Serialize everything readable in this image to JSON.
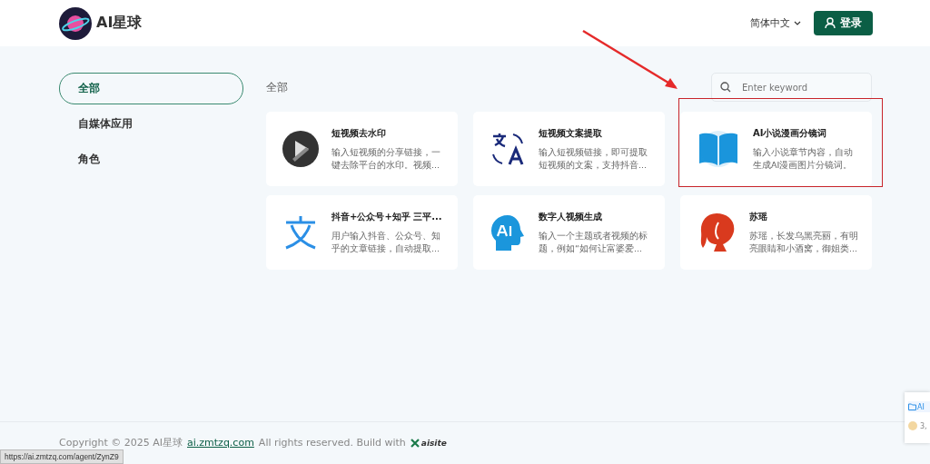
{
  "header": {
    "logo_text": "AI星球",
    "language": "简体中文",
    "login_button": "登录"
  },
  "sidebar": {
    "items": [
      {
        "label": "全部",
        "selected": true
      },
      {
        "label": "自媒体应用",
        "selected": false
      },
      {
        "label": "角色",
        "selected": false
      }
    ]
  },
  "content": {
    "heading": "全部",
    "search": {
      "placeholder": "Enter keyword"
    },
    "cards": [
      {
        "kind": "watermark",
        "title": "短视频去水印",
        "description": "输入短视频的分享链接，一键去除平台的水印。视频...",
        "highlighted": false
      },
      {
        "kind": "translate",
        "title": "短视频文案提取",
        "description": "输入短视频链接，即可提取短视频的文案，支持抖音...",
        "highlighted": false
      },
      {
        "kind": "book",
        "title": "AI小说漫画分镜词",
        "description": "输入小说章节内容，自动生成AI漫画图片分镜词。",
        "highlighted": true
      },
      {
        "kind": "text",
        "title": "抖音+公众号+知乎 三平...",
        "description": "用户输入抖音、公众号、知乎的文章链接，自动提取...",
        "highlighted": false
      },
      {
        "kind": "head",
        "title": "数字人视频生成",
        "description": "输入一个主题或者视频的标题，例如“如何让富婆爱...",
        "highlighted": false
      },
      {
        "kind": "portrait",
        "title": "苏瑶",
        "description": "苏瑶，长发乌黑亮丽，有明亮眼睛和小酒窝，御姐类...",
        "highlighted": false
      }
    ]
  },
  "side_widget": {
    "link": "AI",
    "count": "3,"
  },
  "footer": {
    "copyright": "Copyright © 2025 AI星球",
    "link": "ai.zmtzq.com",
    "rights": "All rights reserved. Build with",
    "brand": "aisite"
  },
  "status_url": "https://ai.zmtzq.com/agent/ZynZ9"
}
